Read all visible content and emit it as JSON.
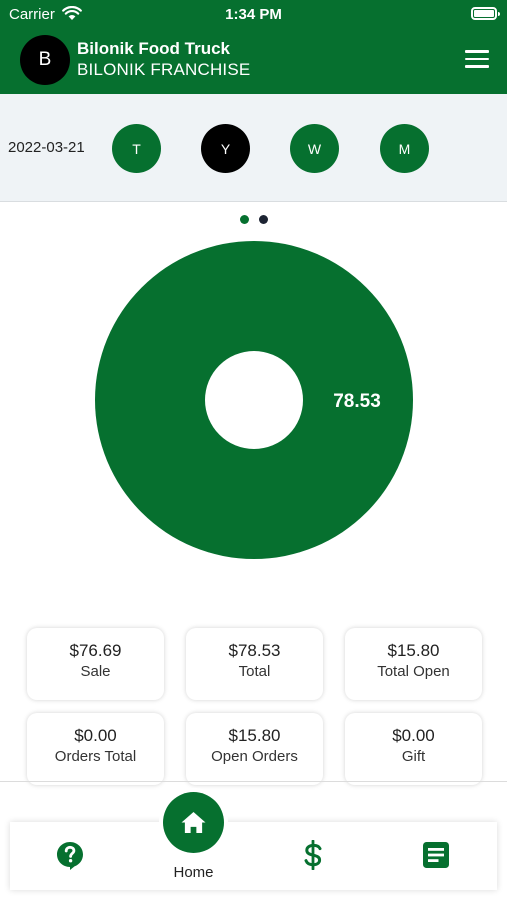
{
  "status_bar": {
    "carrier": "Carrier",
    "time": "1:34 PM"
  },
  "header": {
    "avatar_initial": "B",
    "title": "Bilonik Food Truck",
    "subtitle": "BILONIK FRANCHISE"
  },
  "filter": {
    "date": "2022-03-21",
    "periods": [
      {
        "label": "T",
        "active": false
      },
      {
        "label": "Y",
        "active": true
      },
      {
        "label": "W",
        "active": false
      },
      {
        "label": "M",
        "active": false
      }
    ]
  },
  "pager": {
    "page_count": 2,
    "current_page": 1
  },
  "chart_data": {
    "type": "pie",
    "donut": true,
    "slices": [
      {
        "value": 78.53,
        "label": "78.53",
        "color": "#06702f"
      }
    ]
  },
  "stats": [
    {
      "value": "$76.69",
      "label": "Sale"
    },
    {
      "value": "$78.53",
      "label": "Total"
    },
    {
      "value": "$15.80",
      "label": "Total Open"
    },
    {
      "value": "$0.00",
      "label": "Orders Total"
    },
    {
      "value": "$15.80",
      "label": "Open Orders"
    },
    {
      "value": "$0.00",
      "label": "Gift"
    }
  ],
  "bottom_nav": {
    "items": [
      {
        "icon": "help-icon"
      },
      {
        "icon": "home-icon",
        "label": "Home",
        "active": true
      },
      {
        "icon": "dollar-icon"
      },
      {
        "icon": "report-icon"
      }
    ]
  },
  "colors": {
    "primary": "#06702f",
    "active_period": "#000000",
    "filter_bg": "#eff3f6",
    "pager_inactive": "#1d2433"
  }
}
